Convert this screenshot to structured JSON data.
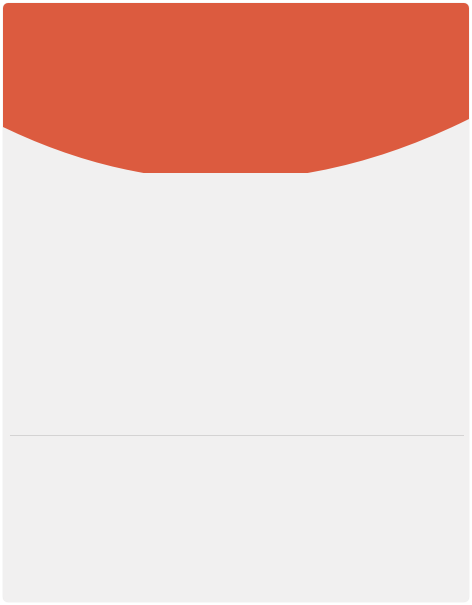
{
  "colors": {
    "header": "#dc5b3f",
    "card_background": "#f1f0f0",
    "divider": "#d4d3d3"
  }
}
